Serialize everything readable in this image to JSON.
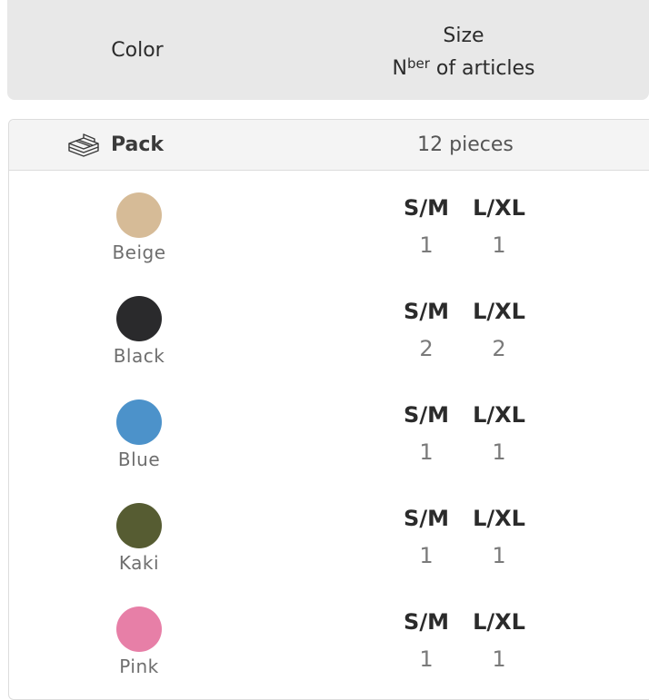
{
  "header": {
    "color_label": "Color",
    "size_label": "Size",
    "count_label_prefix": "N",
    "count_label_sup": "ber",
    "count_label_suffix": " of articles"
  },
  "pack": {
    "icon": "pack-stack-icon",
    "label": "Pack",
    "quantity": "12 pieces"
  },
  "rows": [
    {
      "color_name": "Beige",
      "swatch": "#d6bb97",
      "sizes": [
        {
          "label": "S/M",
          "qty": "1"
        },
        {
          "label": "L/XL",
          "qty": "1"
        }
      ]
    },
    {
      "color_name": "Black",
      "swatch": "#2a2a2c",
      "sizes": [
        {
          "label": "S/M",
          "qty": "2"
        },
        {
          "label": "L/XL",
          "qty": "2"
        }
      ]
    },
    {
      "color_name": "Blue",
      "swatch": "#4c92ca",
      "sizes": [
        {
          "label": "S/M",
          "qty": "1"
        },
        {
          "label": "L/XL",
          "qty": "1"
        }
      ]
    },
    {
      "color_name": "Kaki",
      "swatch": "#565c32",
      "sizes": [
        {
          "label": "S/M",
          "qty": "1"
        },
        {
          "label": "L/XL",
          "qty": "1"
        }
      ]
    },
    {
      "color_name": "Pink",
      "swatch": "#e77fa7",
      "sizes": [
        {
          "label": "S/M",
          "qty": "1"
        },
        {
          "label": "L/XL",
          "qty": "1"
        }
      ]
    }
  ]
}
